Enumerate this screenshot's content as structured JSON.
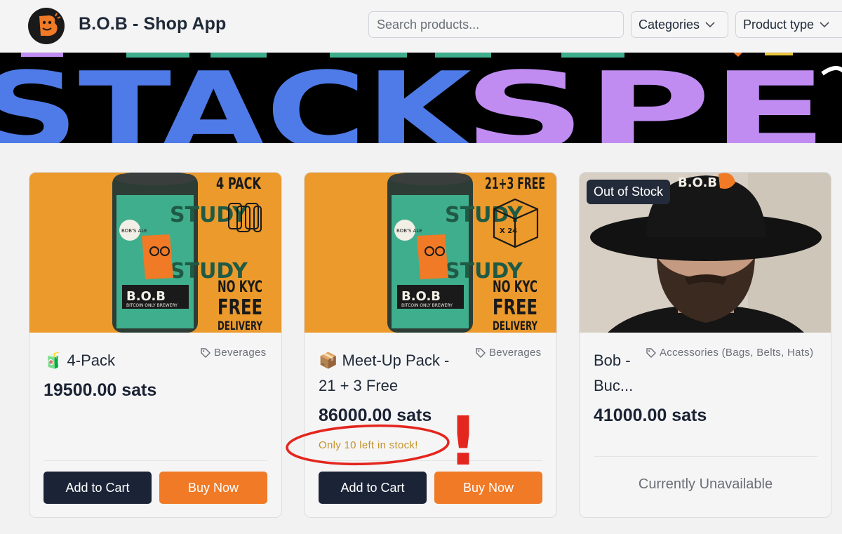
{
  "header": {
    "title": "B.O.B - Shop App",
    "search_placeholder": "Search products...",
    "categories_label": "Categories",
    "product_type_label": "Product type"
  },
  "banner": {
    "text_blue": "STACK",
    "text_purple": "SPE"
  },
  "products": [
    {
      "icon": "🧃",
      "name": "4-Pack",
      "category": "Beverages",
      "price": "19500.00 sats",
      "add_to_cart": "Add to Cart",
      "buy_now": "Buy Now",
      "image": {
        "headline": "4 PACK",
        "line1": "NO KYC",
        "line2": "FREE",
        "line3": "DELIVERY",
        "can_brand": "B.O.B",
        "can_sub": "BITCOIN ONLY BREWERY",
        "can_ale": "BOB'S ALE",
        "can_word": "STUDY"
      }
    },
    {
      "icon": "📦",
      "name_line1": "Meet-Up Pack -",
      "name_line2": "21 + 3 Free",
      "category": "Beverages",
      "price": "86000.00 sats",
      "stock_note": "Only 10 left in stock!",
      "add_to_cart": "Add to Cart",
      "buy_now": "Buy Now",
      "image": {
        "headline": "21+3 FREE",
        "box_label": "X 24",
        "line1": "NO KYC",
        "line2": "FREE",
        "line3": "DELIVERY",
        "can_brand": "B.O.B",
        "can_sub": "BITCOIN ONLY BREWERY",
        "can_ale": "BOB'S ALE",
        "can_word": "STUDY"
      }
    },
    {
      "name_line1": "Bob -",
      "name_line2": "Buc...",
      "category": "Accessories (Bags, Belts, Hats)",
      "price": "41000.00 sats",
      "badge": "Out of Stock",
      "unavailable": "Currently Unavailable",
      "image": {
        "hat_text": "B.O.B"
      }
    }
  ],
  "annotation": {
    "mark": "!"
  },
  "colors": {
    "accent_orange": "#f07a26",
    "dark_button": "#1b2437",
    "stock_warning": "#c2932a",
    "annotation_red": "#e3261e",
    "banner_blue": "#4f7be8",
    "banner_purple": "#c08cf2",
    "image_orange": "#ec9a2c",
    "can_green": "#3fae8c"
  }
}
